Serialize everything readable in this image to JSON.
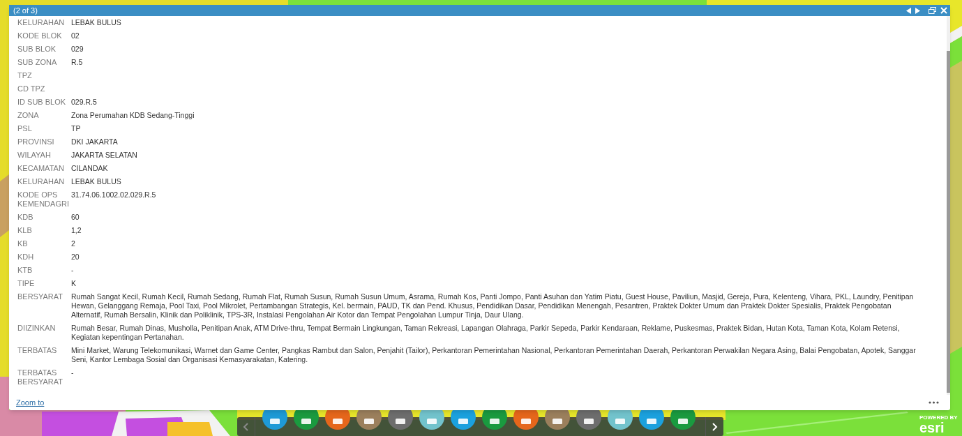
{
  "popup": {
    "title": "(2 of 3)",
    "fields": [
      {
        "label": "KELURAHAN",
        "value": "LEBAK BULUS"
      },
      {
        "label": "KODE BLOK",
        "value": "02"
      },
      {
        "label": "SUB BLOK",
        "value": "029"
      },
      {
        "label": "SUB ZONA",
        "value": "R.5"
      },
      {
        "label": "TPZ"
      },
      {
        "label": "CD TPZ"
      },
      {
        "label": "ID SUB BLOK",
        "value": "029.R.5"
      },
      {
        "label": "ZONA",
        "value": "Zona Perumahan KDB Sedang-Tinggi"
      },
      {
        "label": "PSL",
        "value": "TP"
      },
      {
        "label": "PROVINSI",
        "value": "DKI JAKARTA"
      },
      {
        "label": "WILAYAH",
        "value": "JAKARTA SELATAN"
      },
      {
        "label": "KECAMATAN",
        "value": "CILANDAK"
      },
      {
        "label": "KELURAHAN",
        "value": "LEBAK BULUS"
      },
      {
        "label": "KODE OPS KEMENDAGRI",
        "value": "31.74.06.1002.02.029.R.5"
      },
      {
        "label": "KDB",
        "value": "60"
      },
      {
        "label": "KLB",
        "value": "1,2"
      },
      {
        "label": "KB",
        "value": "2"
      },
      {
        "label": "KDH",
        "value": "20"
      },
      {
        "label": "KTB",
        "value": "-"
      },
      {
        "label": "TIPE",
        "value": "K"
      },
      {
        "label": "BERSYARAT",
        "value": "Rumah Sangat Kecil, Rumah Kecil, Rumah Sedang, Rumah Flat, Rumah Susun, Rumah Susun Umum, Asrama, Rumah Kos, Panti Jompo, Panti Asuhan dan Yatim Piatu, Guest House, Paviliun, Masjid, Gereja, Pura, Kelenteng, Vihara, PKL, Laundry, Penitipan Hewan, Gelanggang Remaja, Pool Taxi, Pool Mikrolet, Pertambangan Strategis, Kel. bermain, PAUD, TK dan Pend. Khusus, Pendidikan Dasar, Pendidikan Menengah, Pesantren, Praktek Dokter Umum dan Praktek Dokter Spesialis, Praktek Pengobatan Alternatif, Rumah Bersalin, Klinik dan Poliklinik, TPS-3R, Instalasi Pengolahan Air Kotor dan Tempat Pengolahan Lumpur Tinja, Daur Ulang."
      },
      {
        "label": "DIIZINKAN",
        "value": "Rumah Besar, Rumah Dinas, Musholla, Penitipan Anak, ATM Drive-thru, Tempat Bermain Lingkungan, Taman Rekreasi, Lapangan Olahraga, Parkir Sepeda, Parkir Kendaraan, Reklame, Puskesmas, Praktek Bidan, Hutan Kota, Taman Kota, Kolam Retensi, Kegiatan kepentingan Pertanahan."
      },
      {
        "label": "TERBATAS",
        "value": "Mini Market, Warung Telekomunikasi, Warnet dan Game Center, Pangkas Rambut dan Salon, Penjahit (Tailor), Perkantoran Pemerintahan Nasional, Perkantoran Pemerintahan Daerah, Perkantoran Perwakilan Negara Asing, Balai Pengobatan, Apotek, Sanggar Seni, Kantor Lembaga Sosial dan Organisasi Kemasyarakatan, Katering."
      },
      {
        "label": "TERBATAS BERSYARAT",
        "value": "-"
      }
    ],
    "zoom_link": "Zoom to"
  },
  "toolbar": {
    "prev_disabled": true,
    "next_disabled": false,
    "apps": [
      {
        "color": "#1e9ad6"
      },
      {
        "color": "#1a9a3f"
      },
      {
        "color": "#e5661b"
      },
      {
        "color": "#9b7f5c"
      },
      {
        "color": "#6d6d6d"
      },
      {
        "color": "#72c3cc"
      },
      {
        "color": "#1ba1de"
      },
      {
        "color": "#1a9a3f"
      },
      {
        "color": "#e5661b"
      },
      {
        "color": "#9b7f5c"
      },
      {
        "color": "#6d6d6d"
      },
      {
        "color": "#72c3cc"
      },
      {
        "color": "#1ba1de"
      },
      {
        "color": "#1a9a3f"
      }
    ]
  },
  "attribution": {
    "caption": "POWERED BY",
    "brand": "esri"
  }
}
